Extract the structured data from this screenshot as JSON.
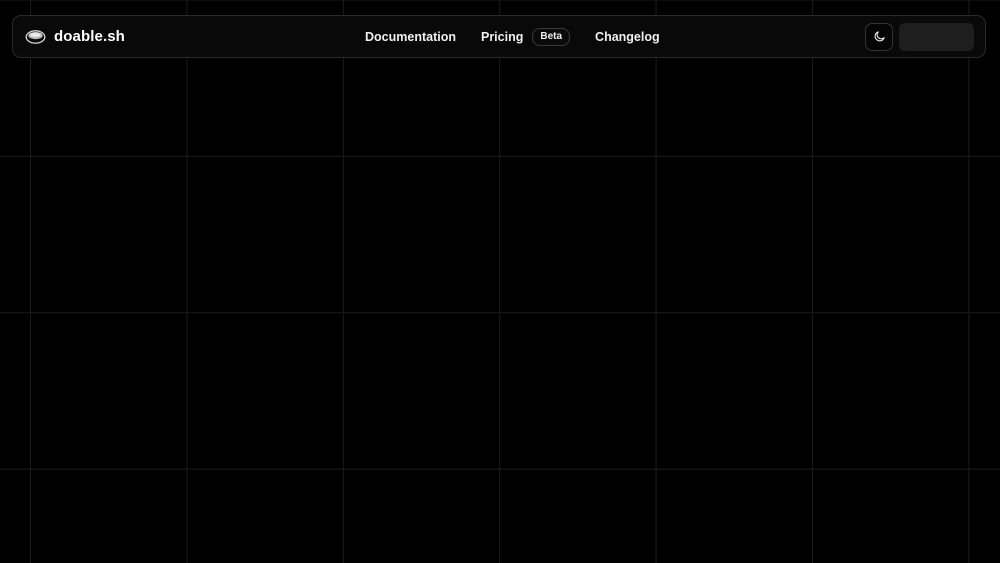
{
  "brand": {
    "name": "doable.sh",
    "logo_icon": "saucer-logo-icon"
  },
  "nav": {
    "documentation": "Documentation",
    "pricing": "Pricing",
    "pricing_badge": "Beta",
    "changelog": "Changelog"
  },
  "actions": {
    "theme_icon": "moon-icon"
  },
  "colors": {
    "background": "#000000",
    "grid_line": "#1c1c1c",
    "navbar_border": "#2a2a2a",
    "text": "#f0f0f0",
    "placeholder_button": "#1e1e1e"
  }
}
